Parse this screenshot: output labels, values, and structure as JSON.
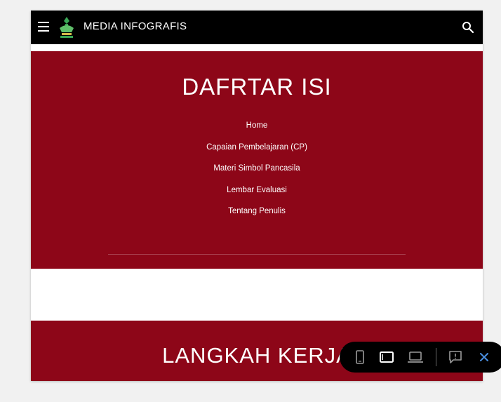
{
  "header": {
    "site_title": "MEDIA INFOGRAFIS"
  },
  "section_toc": {
    "title": "DAFRTAR ISI",
    "links": [
      "Home",
      "Capaian Pembelajaran (CP)",
      "Materi Simbol Pancasila",
      "Lembar Evaluasi",
      "Tentang Penulis"
    ]
  },
  "section_steps": {
    "title": "LANGKAH KERJA"
  },
  "preview_bar": {
    "icons": [
      "phone-icon",
      "tablet-icon",
      "laptop-icon",
      "feedback-icon",
      "close-icon"
    ],
    "active": "tablet-icon"
  },
  "colors": {
    "header_bg": "#000000",
    "section_bg": "#8d0618",
    "close_blue": "#4a90e2"
  }
}
